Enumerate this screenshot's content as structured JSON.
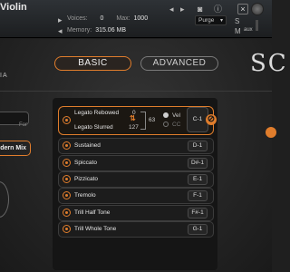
{
  "header": {
    "instrument_name": "Violin",
    "voices_label": "Voices:",
    "voices_value": "0",
    "max_label": "Max:",
    "max_value": "1000",
    "memory_label": "Memory:",
    "memory_value": "315.06 MB",
    "purge_label": "Purge",
    "close_glyph": "×",
    "solo_label": "S",
    "mute_label": "M",
    "aux_label": "aux"
  },
  "tabs": {
    "basic": "BASIC",
    "advanced": "ADVANCED"
  },
  "logo_partial": "SC",
  "brand_partial": "IA",
  "left_panel": {
    "field_suffix": "For",
    "mix_button": "dern Mix"
  },
  "legato": {
    "rebowed_label": "Legato Rebowed",
    "slurred_label": "Legato Slurred",
    "rebowed_value": "0",
    "slurred_value": "127",
    "threshold": "63",
    "vel_label": "Vel",
    "cc_label": "CC",
    "key": "C-1",
    "swap_glyph": "⇅"
  },
  "articulations": [
    {
      "label": "Sustained",
      "key": "D-1"
    },
    {
      "label": "Spiccato",
      "key": "D#-1"
    },
    {
      "label": "Pizzicato",
      "key": "E-1"
    },
    {
      "label": "Tremolo",
      "key": "F-1"
    },
    {
      "label": "Trill Half Tone",
      "key": "F#-1"
    },
    {
      "label": "Trill Whole Tone",
      "key": "G-1"
    }
  ],
  "colors": {
    "accent": "#e07d2c",
    "panel_bg": "#151515"
  }
}
